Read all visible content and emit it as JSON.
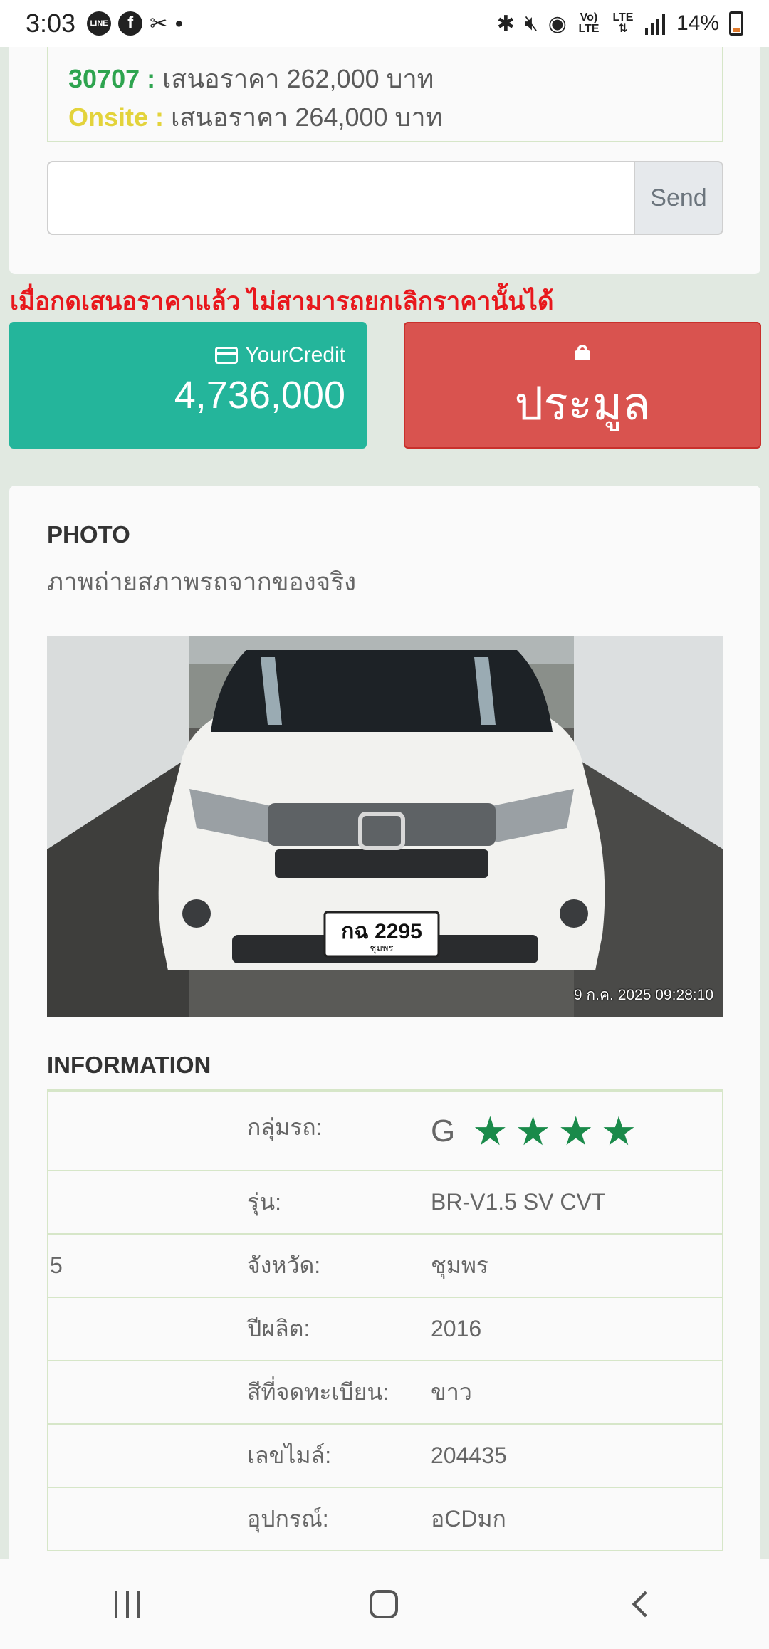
{
  "status_bar": {
    "time": "3:03",
    "left_icons": [
      "line-icon",
      "facebook-icon",
      "tools-icon",
      "dot-icon"
    ],
    "line_label": "LINE",
    "right_icons": [
      "bluetooth-icon",
      "mute-icon",
      "hotspot-icon",
      "volte-icon",
      "lte-icon",
      "signal-icon"
    ],
    "volte_label": "Vo) LTE",
    "lte_label": "LTE ⇅",
    "battery": "14%"
  },
  "bids": [
    {
      "code": "30707 :",
      "text": "เสนอราคา 262,000 บาท",
      "color": "#2ea44f"
    },
    {
      "code": "Onsite :",
      "text": "เสนอราคา 264,000 บาท",
      "color": "#e3d33b"
    }
  ],
  "send": {
    "placeholder": "",
    "value": "",
    "button": "Send"
  },
  "warning": "เมื่อกดเสนอราคาแล้ว ไม่สามารถยกเลิกราคานั้นได้",
  "credit": {
    "label": "YourCredit",
    "value": "4,736,000"
  },
  "auction": {
    "label": "ประมูล"
  },
  "photo_section": {
    "title": "PHOTO",
    "subtitle": "ภาพถ่ายสภาพรถจากของจริง",
    "plate": "กฉ 2295",
    "plate_province": "ชุมพร",
    "timestamp": "9 ก.ค. 2025 09:28:10"
  },
  "info_section": {
    "title": "INFORMATION",
    "row_index": "5",
    "grade": {
      "label": "กลุ่มรถ:",
      "letter": "G",
      "stars": 4
    },
    "rows": [
      {
        "label": "รุ่น:",
        "value": "BR-V1.5 SV CVT"
      },
      {
        "label": "จังหวัด:",
        "value": "ชุมพร"
      },
      {
        "label": "ปีผลิต:",
        "value": "2016"
      },
      {
        "label": "สีที่จดทะเบียน:",
        "value": "ขาว"
      },
      {
        "label": "เลขไมล์:",
        "value": "204435"
      },
      {
        "label": "อุปกรณ์:",
        "value": "อCDมก"
      }
    ]
  }
}
